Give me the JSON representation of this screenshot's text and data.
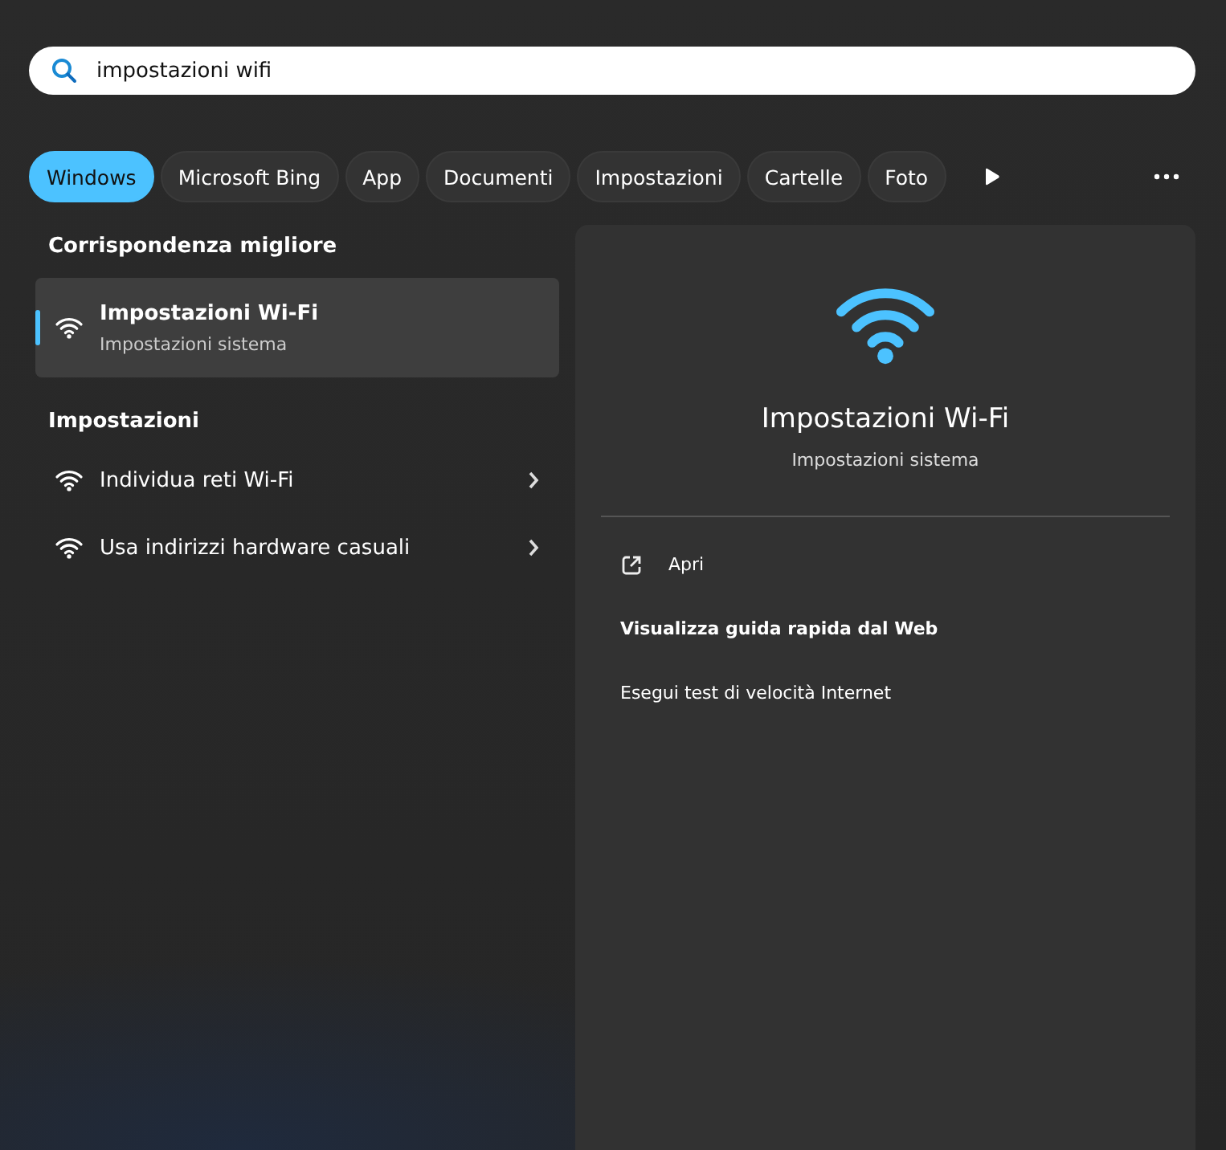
{
  "search": {
    "value": "impostazioni wifi"
  },
  "filters": [
    {
      "label": "Windows",
      "selected": true
    },
    {
      "label": "Microsoft Bing",
      "selected": false
    },
    {
      "label": "App",
      "selected": false
    },
    {
      "label": "Documenti",
      "selected": false
    },
    {
      "label": "Impostazioni",
      "selected": false
    },
    {
      "label": "Cartelle",
      "selected": false
    },
    {
      "label": "Foto",
      "selected": false
    }
  ],
  "best_match": {
    "heading": "Corrispondenza migliore",
    "title": "Impostazioni Wi-Fi",
    "subtitle": "Impostazioni sistema",
    "selected": true
  },
  "settings": {
    "heading": "Impostazioni",
    "items": [
      {
        "label": "Individua reti Wi-Fi"
      },
      {
        "label": "Usa indirizzi hardware casuali"
      }
    ]
  },
  "preview": {
    "title": "Impostazioni Wi-Fi",
    "subtitle": "Impostazioni sistema",
    "actions": [
      {
        "kind": "open",
        "label": "Apri"
      },
      {
        "kind": "bold",
        "label": "Visualizza guida rapida dal Web"
      },
      {
        "kind": "plain",
        "label": "Esegui test di velocità Internet"
      }
    ]
  }
}
